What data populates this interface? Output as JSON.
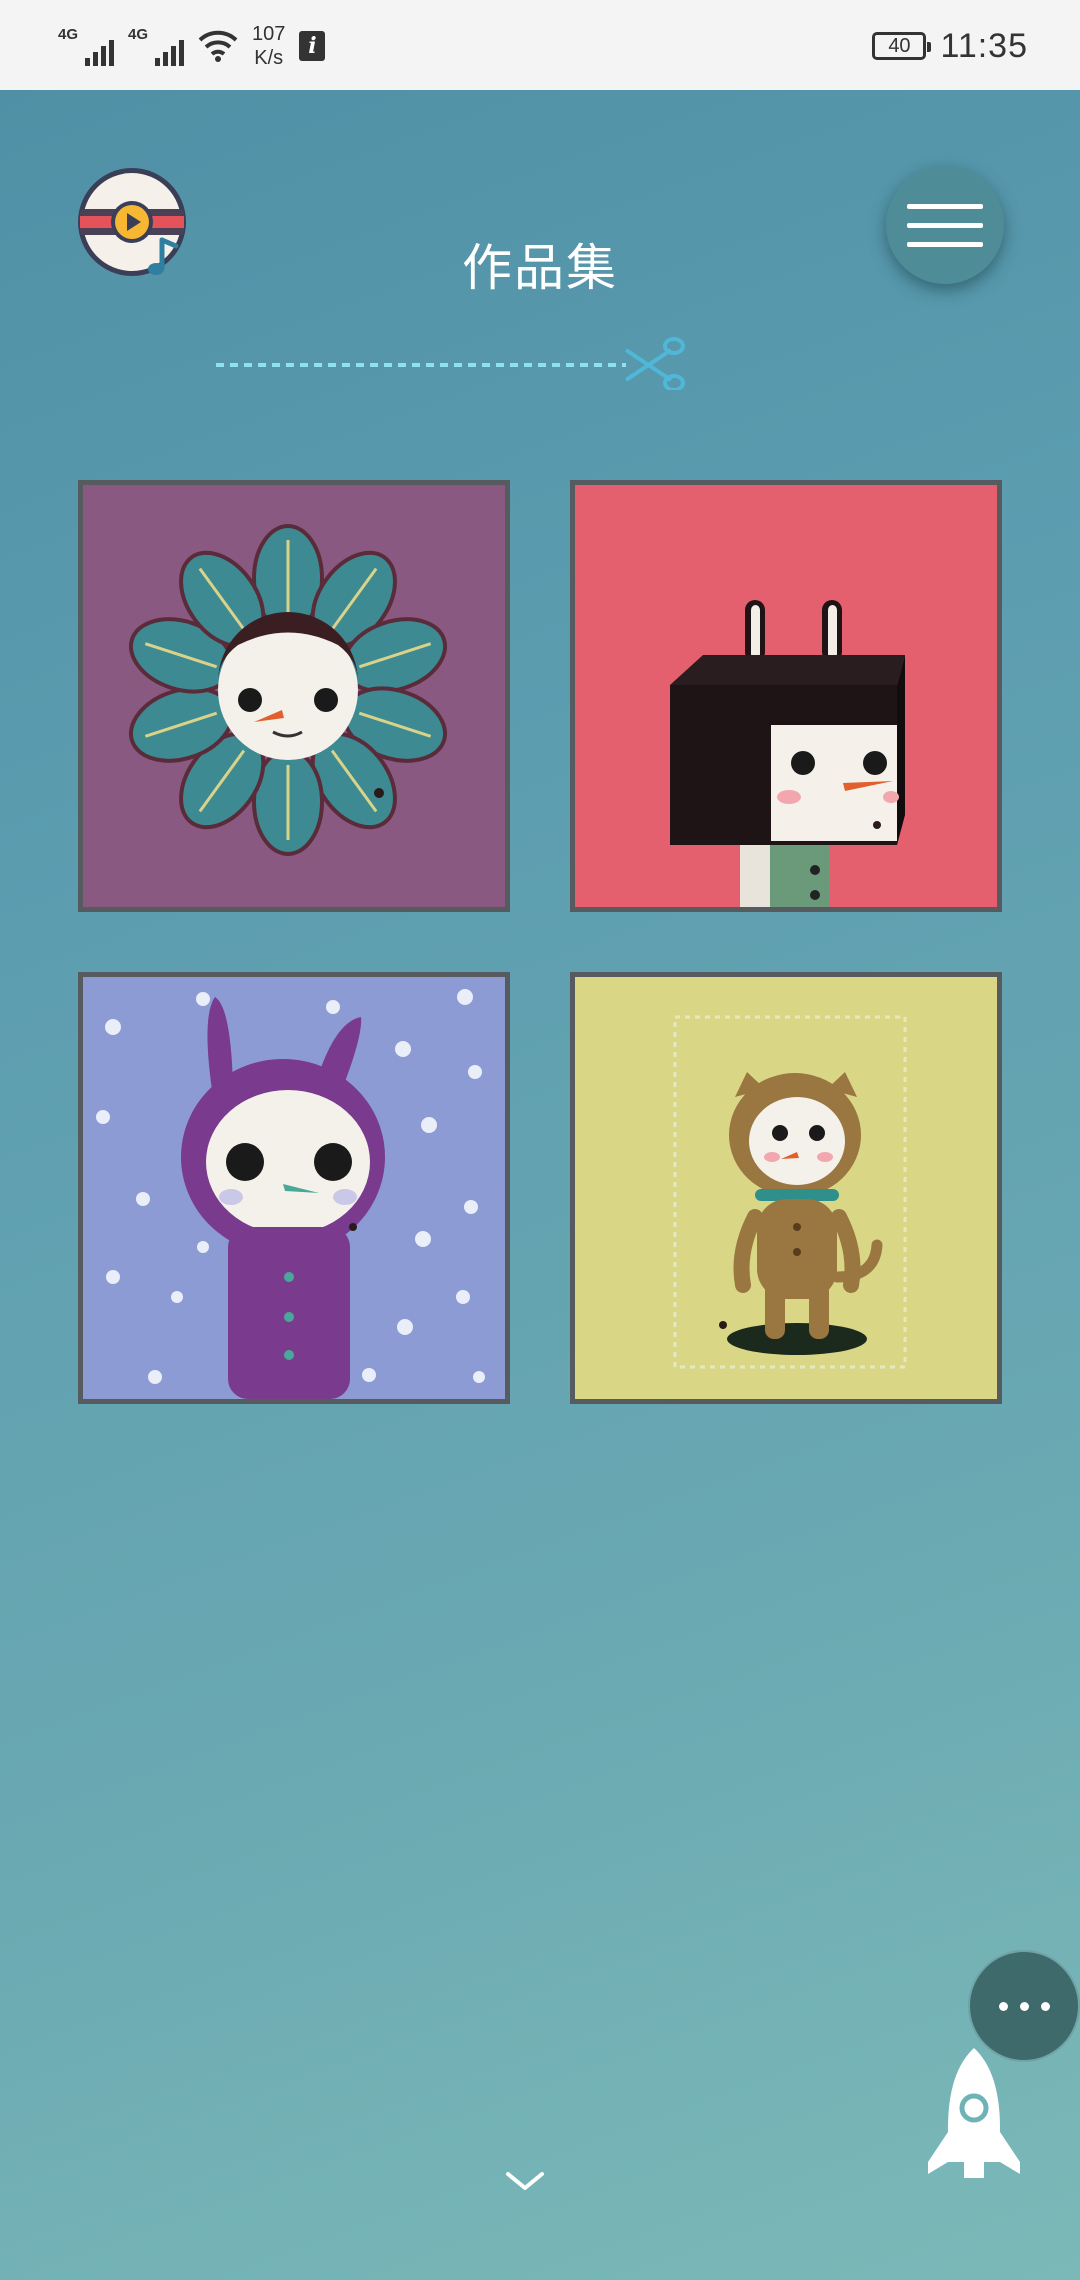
{
  "status_bar": {
    "network_1": "4G",
    "network_2": "4G",
    "speed_value": "107",
    "speed_unit": "K/s",
    "info_badge": "i",
    "battery": "40",
    "time": "11:35"
  },
  "header": {
    "title": "作品集",
    "logo_icon": "music-video-disc-icon",
    "menu_icon": "hamburger-menu-icon",
    "divider_icon": "scissors-icon"
  },
  "gallery": {
    "items": [
      {
        "icon": "flower-snowman-artwork",
        "background": "#8e5c86"
      },
      {
        "icon": "box-bunny-artwork",
        "background": "#e4606e"
      },
      {
        "icon": "purple-bunny-artwork",
        "background": "#8c9bd4"
      },
      {
        "icon": "brown-cat-artwork",
        "background": "#d9d786"
      }
    ]
  },
  "floating": {
    "more_icon": "more-dots-icon",
    "rocket_icon": "rocket-icon",
    "scroll_icon": "chevron-down-icon"
  }
}
